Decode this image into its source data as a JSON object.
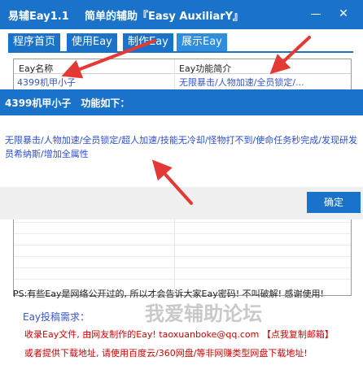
{
  "window": {
    "app_name": "易辅Eay1.1",
    "subtitle": "简单的辅助『Easy AuxiliarY』",
    "minimize_glyph": "—",
    "close_glyph": "✕"
  },
  "tabs": [
    {
      "label": "程序首页"
    },
    {
      "label": "使用Eay"
    },
    {
      "label": "制作Eay"
    },
    {
      "label": "展示Eay"
    }
  ],
  "list": {
    "columns": [
      "Eay名称",
      "Eay功能简介"
    ],
    "rows": [
      {
        "name": "4399机甲小子",
        "desc": "无限暴击/人物加速/全员锁定/..."
      }
    ]
  },
  "dialog": {
    "title": "4399机甲小子　功能如下：",
    "body": "无限暴击/人物加速/全员锁定/超人加速/技能无冷却/怪物打不到/使命任务秒完成/发现研发员希纳斯/增加全属性",
    "ok_label": "确定"
  },
  "ps_text": "PS:有些Eay是网络公开过的, 所以才会告诉大家Eay密码! 不叫破解! 感谢使用!",
  "watermark": "我爱辅助论坛",
  "submit": {
    "title": "Eay投稿需求：",
    "line1": "收录Eay文件, 由网友制作的Eay! taoxuanboke@qq.com 【点我复制邮箱】",
    "line2": "或者提供下载地址, 请使用百度云/360网盘/等非网赚类型网盘下载地址!"
  },
  "colors": {
    "accent": "#1a73c9",
    "link": "#3a56c8",
    "warning": "#d10000",
    "annotation_arrow": "#e53935"
  }
}
